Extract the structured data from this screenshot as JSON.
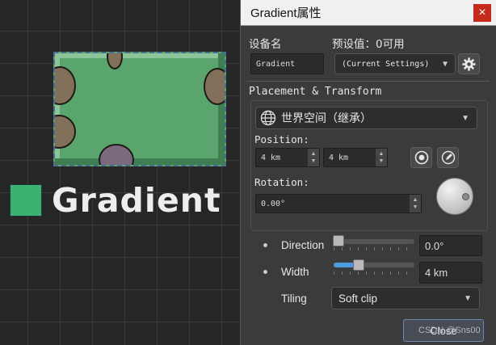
{
  "canvas": {
    "node_label": "Gradient",
    "swatch_color": "#3bb370"
  },
  "dialog": {
    "title": "Gradient属性",
    "close_glyph": "×",
    "device_name_label": "设备名",
    "preset_label": "预设值：0可用",
    "device_name_value": "Gradient",
    "preset_value": "(Current Settings)",
    "section_title": "Placement & Transform",
    "space_value": "世界空间（继承）",
    "position_label": "Position:",
    "position_x": "4 km",
    "position_y": "4 km",
    "rotation_label": "Rotation:",
    "rotation_value": "0.00°",
    "rotation_knob_level": 0,
    "direction_label": "Direction",
    "direction_value": "0.0°",
    "direction_slider_level": 0,
    "width_label": "Width",
    "width_value": "4 km",
    "width_slider_level": 0.3,
    "tiling_label": "Tiling",
    "tiling_value": "Soft clip",
    "close_label": "Close"
  },
  "watermark": "CSDN @Sns00",
  "colors": {
    "accent": "#4d9be0",
    "close_red": "#c42b1c",
    "node_green": "#5aa56e"
  }
}
